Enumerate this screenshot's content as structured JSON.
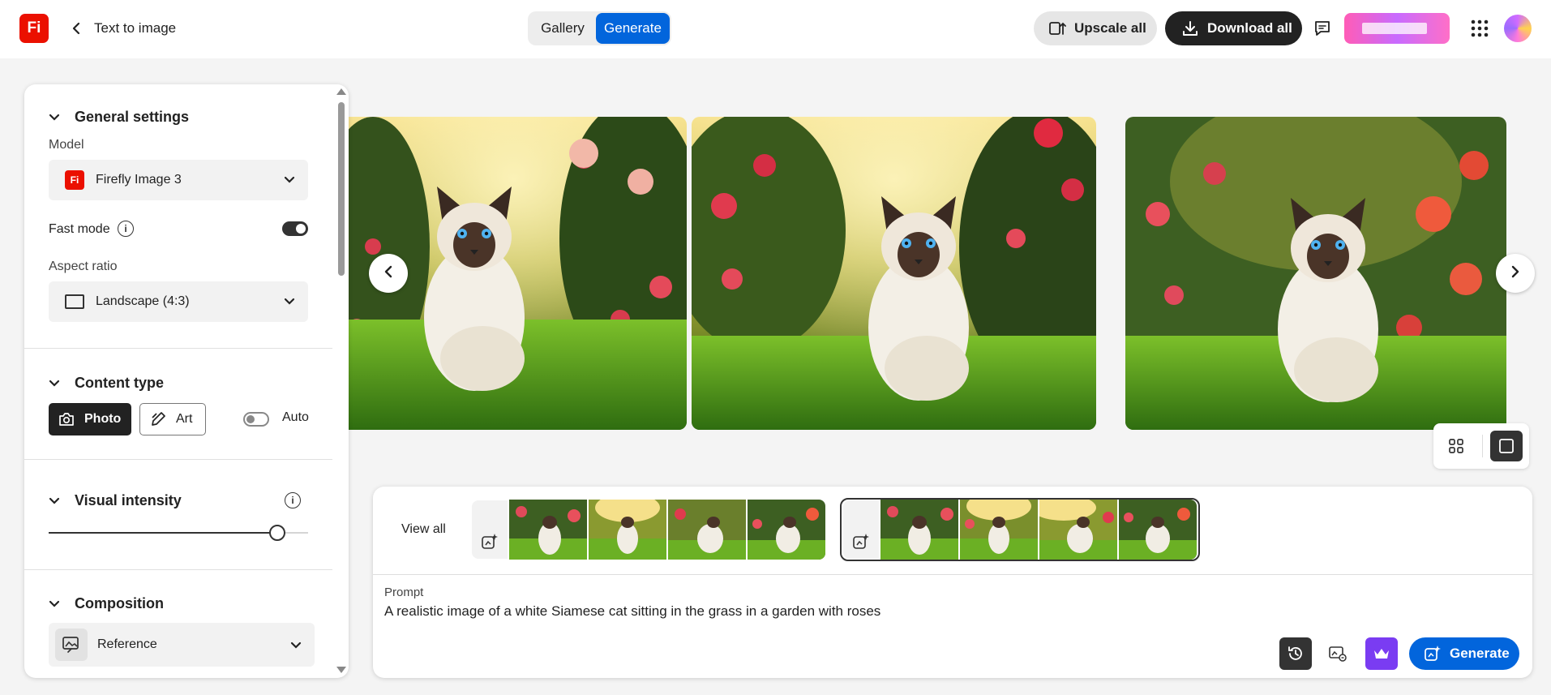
{
  "header": {
    "logo_text": "Fi",
    "page_title": "Text to image",
    "tabs": [
      {
        "label": "Gallery"
      },
      {
        "label": "Generate"
      }
    ],
    "upscale_label": "Upscale all",
    "download_label": "Download all"
  },
  "panel": {
    "general": {
      "title": "General settings",
      "model_label": "Model",
      "model_badge": "Fi",
      "model_value": "Firefly Image 3",
      "fast_mode_label": "Fast mode",
      "fast_mode_on": true,
      "aspect_label": "Aspect ratio",
      "aspect_value": "Landscape (4:3)"
    },
    "content_type": {
      "title": "Content type",
      "photo_label": "Photo",
      "art_label": "Art",
      "auto_label": "Auto",
      "auto_on": false,
      "selected": "Photo"
    },
    "visual_intensity": {
      "title": "Visual intensity",
      "value_fraction": 0.88
    },
    "composition": {
      "title": "Composition",
      "reference_label": "Reference"
    }
  },
  "bottom": {
    "view_all_label": "View all",
    "prompt_label": "Prompt",
    "prompt_text": "A realistic image of a white Siamese cat sitting in the grass in a garden with roses",
    "generate_label": "Generate"
  },
  "colors": {
    "accent": "#0265dc",
    "brand": "#eb1000",
    "premium": "#7a3cf2"
  },
  "icons": [
    "back-chevron-icon",
    "upscale-icon",
    "download-icon",
    "feedback-icon",
    "apps-grid-icon",
    "info-icon",
    "camera-icon",
    "brush-icon",
    "reference-image-icon",
    "history-icon",
    "style-reference-icon",
    "crown-icon",
    "generate-sparkle-icon",
    "grid-view-icon",
    "single-view-icon"
  ]
}
